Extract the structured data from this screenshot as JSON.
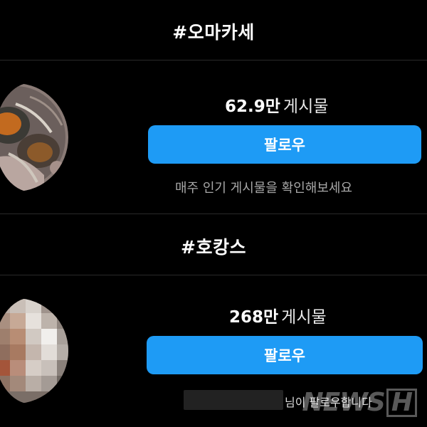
{
  "sections": [
    {
      "hashtag": "#오마카세",
      "post_count_number": "62.9만",
      "post_count_unit": "게시물",
      "follow_label": "팔로우",
      "helper_text": "매주 인기 게시물을 확인해보세요",
      "avatar_icon": "seafood-photo-avatar"
    },
    {
      "hashtag": "#호캉스",
      "post_count_number": "268만",
      "post_count_unit": "게시물",
      "follow_label": "팔로우",
      "followed_by_text": "님이 팔로우합니다",
      "avatar_icon": "pixelated-photo-avatar"
    }
  ],
  "watermark": {
    "text": "NEWS",
    "letter": "H"
  },
  "colors": {
    "background": "#000000",
    "button": "#1e9bf5",
    "helper_text": "#a8a8a8"
  }
}
